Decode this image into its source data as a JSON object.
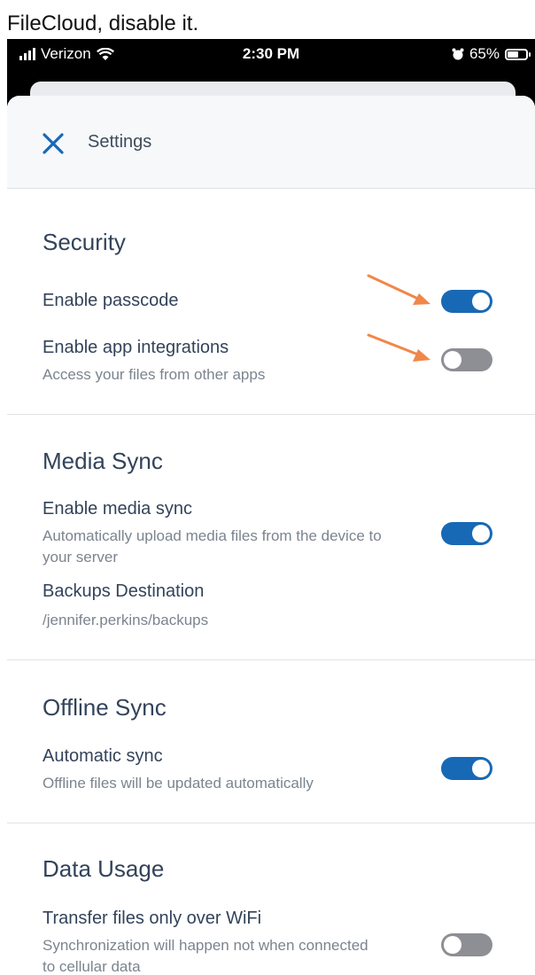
{
  "caption": "FileCloud, disable it.",
  "status_bar": {
    "carrier": "Verizon",
    "time": "2:30 PM",
    "battery_percent": "65%",
    "battery_level": 0.65
  },
  "header": {
    "title": "Settings"
  },
  "sections": {
    "security": {
      "title": "Security",
      "passcode": {
        "label": "Enable passcode",
        "enabled": true
      },
      "integrations": {
        "label": "Enable app integrations",
        "description": "Access your files from other apps",
        "enabled": false
      }
    },
    "media_sync": {
      "title": "Media Sync",
      "enable": {
        "label": "Enable media sync",
        "description": "Automatically upload media files from the device to your server",
        "enabled": true
      },
      "backups": {
        "label": "Backups Destination",
        "value": "/jennifer.perkins/backups"
      }
    },
    "offline_sync": {
      "title": "Offline Sync",
      "auto": {
        "label": "Automatic sync",
        "description": "Offline files will be updated automatically",
        "enabled": true
      }
    },
    "data_usage": {
      "title": "Data Usage",
      "wifi": {
        "label": "Transfer files only over WiFi",
        "description": "Synchronization will happen not when connected to cellular data",
        "enabled": false
      }
    }
  },
  "colors": {
    "accent": "#1869b5",
    "toggle_off": "#8d8f94",
    "annotation_arrow": "#f0874a",
    "text": "#33435a"
  }
}
